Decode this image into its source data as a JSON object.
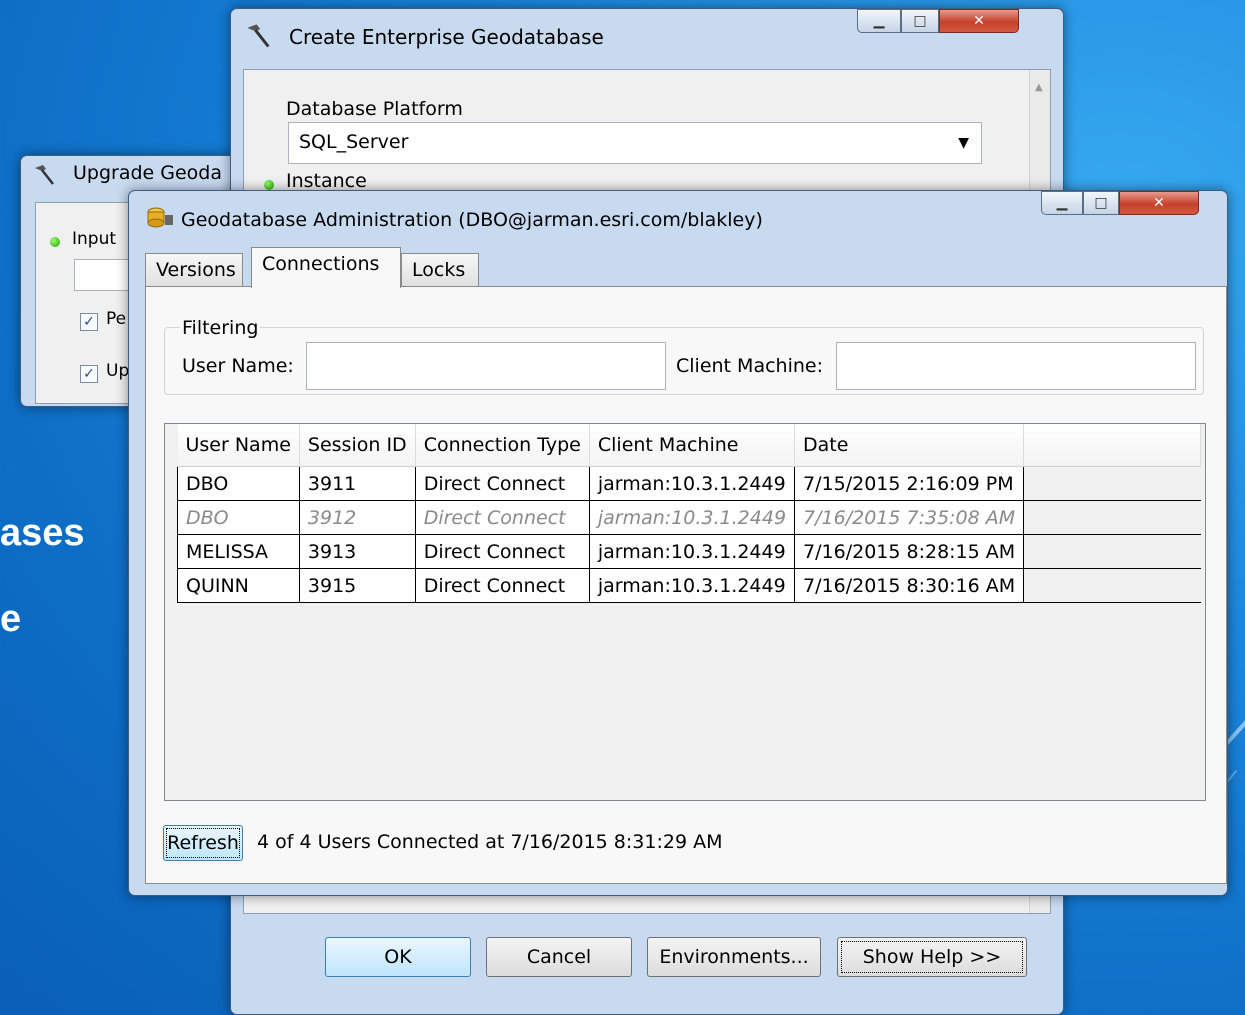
{
  "background": {
    "text_line1": "ases",
    "text_line2": "e"
  },
  "upgrade_window": {
    "title": "Upgrade Geoda",
    "input_label": "Input",
    "check1_label": "Pe",
    "check2_label": "Up"
  },
  "create_window": {
    "title": "Create Enterprise Geodatabase",
    "platform_label": "Database Platform",
    "platform_value": "SQL_Server",
    "instance_label": "Instance",
    "ok_label": "OK",
    "cancel_label": "Cancel",
    "environments_label": "Environments...",
    "showhelp_label": "Show Help >>"
  },
  "admin_window": {
    "title": "Geodatabase Administration (DBO@jarman.esri.com/blakley)",
    "tabs": [
      {
        "label": "Versions",
        "active": false
      },
      {
        "label": "Connections",
        "active": true
      },
      {
        "label": "Locks",
        "active": false
      }
    ],
    "filtering_label": "Filtering",
    "username_label": "User Name:",
    "username_value": "",
    "clientmachine_label": "Client Machine:",
    "clientmachine_value": "",
    "columns": [
      "User Name",
      "Session ID",
      "Connection Type",
      "Client Machine",
      "Date"
    ],
    "rows": [
      {
        "cells": [
          "DBO",
          "3911",
          "Direct Connect",
          "jarman:10.3.1.2449",
          "7/15/2015 2:16:09 PM"
        ],
        "dim": false
      },
      {
        "cells": [
          "DBO",
          "3912",
          "Direct Connect",
          "jarman:10.3.1.2449",
          "7/16/2015 7:35:08 AM"
        ],
        "dim": true
      },
      {
        "cells": [
          "MELISSA",
          "3913",
          "Direct Connect",
          "jarman:10.3.1.2449",
          "7/16/2015 8:28:15 AM"
        ],
        "dim": false
      },
      {
        "cells": [
          "QUINN",
          "3915",
          "Direct Connect",
          "jarman:10.3.1.2449",
          "7/16/2015 8:30:16 AM"
        ],
        "dim": false
      }
    ],
    "refresh_label": "Refresh",
    "status_text": "4 of 4 Users Connected at 7/16/2015 8:31:29 AM"
  },
  "icons": {
    "hammer": "hammer-icon",
    "geodatabase": "geodatabase-icon",
    "dropdown": "chevron-down-icon"
  }
}
